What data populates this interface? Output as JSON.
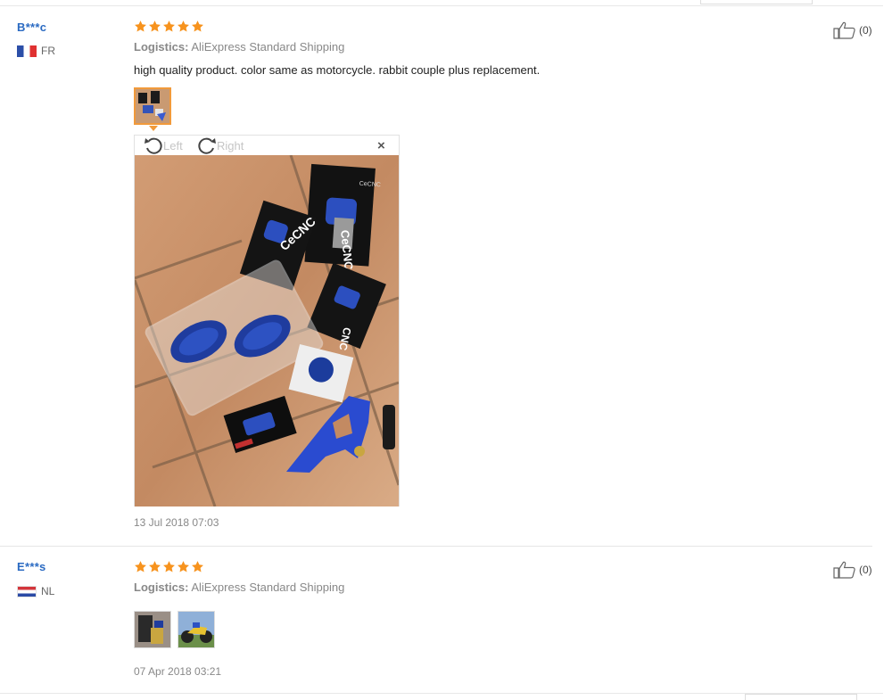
{
  "reviews": [
    {
      "user": "B***c",
      "country": "FR",
      "rating": 5,
      "logistics_label": "Logistics:",
      "logistics_value": "AliExpress Standard Shipping",
      "text": "high quality product. color same as motorcycle. rabbit couple plus replacement.",
      "helpful_count": "(0)",
      "date": "13 Jul 2018 07:03",
      "viewer": {
        "rotate_left": "Left",
        "rotate_right": "Right",
        "close": "×"
      },
      "photo_text": {
        "left_sticker": "CeCNC",
        "top_sticker": "CeCNC",
        "right_sticker": "CNC",
        "brand": "CeCNC"
      }
    },
    {
      "user": "E***s",
      "country": "NL",
      "rating": 5,
      "logistics_label": "Logistics:",
      "logistics_value": "AliExpress Standard Shipping",
      "helpful_count": "(0)",
      "date": "07 Apr 2018 03:21"
    }
  ],
  "colors": {
    "accent": "#f19a3b",
    "star": "#f7931e",
    "username": "#2a6ac2",
    "muted": "#888888"
  },
  "icons": {
    "helpful": "thumbs-up-icon",
    "rotate_left": "rotate-left-icon",
    "rotate_right": "rotate-right-icon",
    "close": "close-icon",
    "star": "star-icon"
  }
}
